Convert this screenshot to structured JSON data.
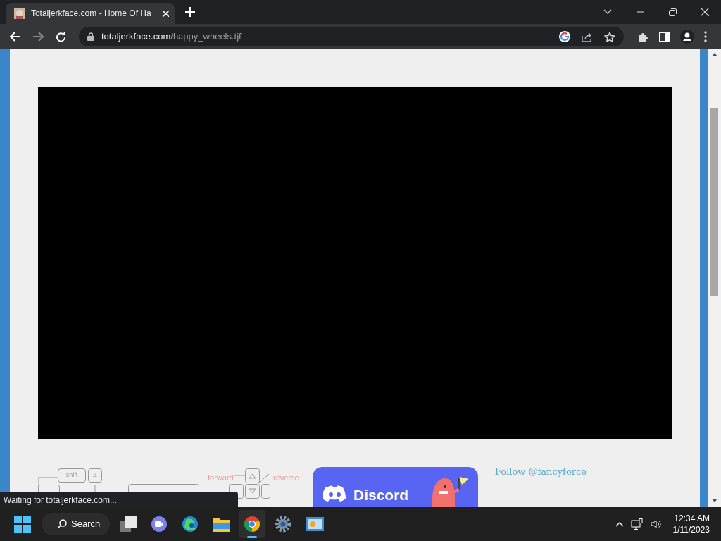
{
  "browser": {
    "tabs": [
      {
        "title": "Totaljerkface.com - Home Of Ha",
        "selected": true
      }
    ],
    "address": {
      "domain": "totaljerkface.com",
      "path": "/happy_wheels.tjf"
    }
  },
  "page": {
    "controls": {
      "keys": [
        "shift",
        "Z"
      ],
      "labels": [
        "forward",
        "reverse"
      ]
    },
    "discord": {
      "label": "Discord"
    },
    "follow": "Follow @fancyforce"
  },
  "status_bubble": "Waiting for totaljerkface.com...",
  "taskbar": {
    "search": "Search",
    "time": "12:34 AM",
    "date": "1/11/2023"
  }
}
